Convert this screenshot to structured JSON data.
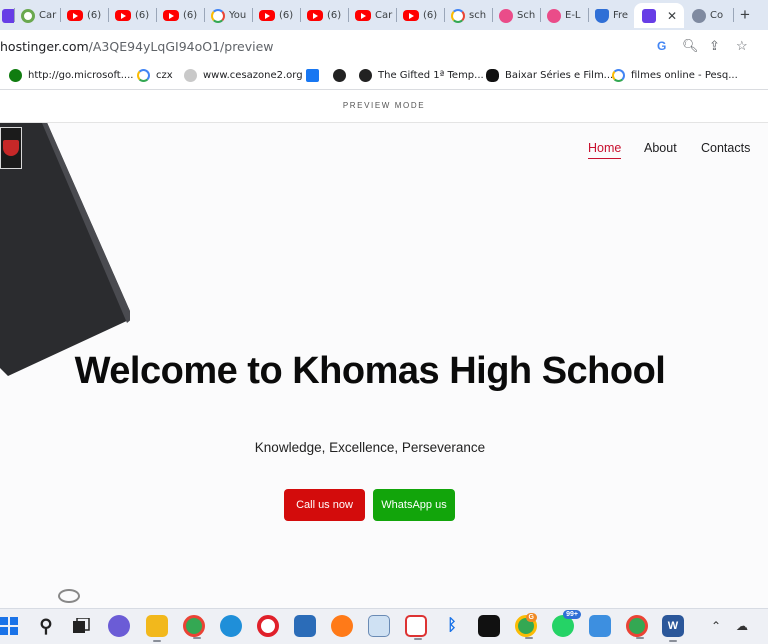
{
  "browser": {
    "tabs": [
      {
        "title": "o",
        "icon": "hostinger-icon",
        "active": false
      },
      {
        "title": "Car",
        "icon": "ring-favicon-icon",
        "active": false
      },
      {
        "title": "(6)",
        "icon": "youtube-icon",
        "active": false
      },
      {
        "title": "(6)",
        "icon": "youtube-icon",
        "active": false
      },
      {
        "title": "(6)",
        "icon": "youtube-icon",
        "active": false
      },
      {
        "title": "You",
        "icon": "google-icon",
        "active": false
      },
      {
        "title": "(6)",
        "icon": "youtube-icon",
        "active": false
      },
      {
        "title": "(6)",
        "icon": "youtube-icon",
        "active": false
      },
      {
        "title": "Car",
        "icon": "youtube-icon",
        "active": false
      },
      {
        "title": "(6)",
        "icon": "youtube-icon",
        "active": false
      },
      {
        "title": "sch",
        "icon": "google-icon",
        "active": false
      },
      {
        "title": "Sch",
        "icon": "dribbble-icon",
        "active": false
      },
      {
        "title": "E-L",
        "icon": "dribbble-icon",
        "active": false
      },
      {
        "title": "Fre",
        "icon": "shield-icon",
        "active": false
      },
      {
        "title": "",
        "icon": "hostinger-icon",
        "active": true
      },
      {
        "title": "Co",
        "icon": "globe-icon",
        "active": false
      }
    ],
    "url_main": "hostinger.com",
    "url_path": "/A3QE94yLqGI94oO1/preview",
    "bookmarks": [
      {
        "label": "http://go.microsoft....",
        "icon": "xbox-icon"
      },
      {
        "label": "czx",
        "icon": "google-icon"
      },
      {
        "label": "www.cesazone2.org",
        "icon": "cesazone-icon"
      },
      {
        "label": "",
        "icon": "facebook-icon"
      },
      {
        "label": "",
        "icon": "globe-icon"
      },
      {
        "label": "The Gifted 1ª Temp...",
        "icon": "globe-icon"
      },
      {
        "label": "Baixar Séries e Film...",
        "icon": "skull-icon"
      },
      {
        "label": "filmes online - Pesq...",
        "icon": "google-icon"
      }
    ]
  },
  "preview": {
    "label": "PREVIEW MODE"
  },
  "site": {
    "nav": {
      "home": "Home",
      "about": "About",
      "contacts": "Contacts"
    },
    "hero_title": "Welcome to Khomas High School",
    "hero_subtitle": "Knowledge, Excellence, Perseverance",
    "call_button": "Call us now",
    "whatsapp_button": "WhatsApp us",
    "colors": {
      "accent": "#c8102e",
      "call": "#d30c0c",
      "whatsapp": "#12a50b"
    }
  },
  "taskbar": {
    "whatsapp_badge": "99+",
    "chrome_badge": "G"
  }
}
